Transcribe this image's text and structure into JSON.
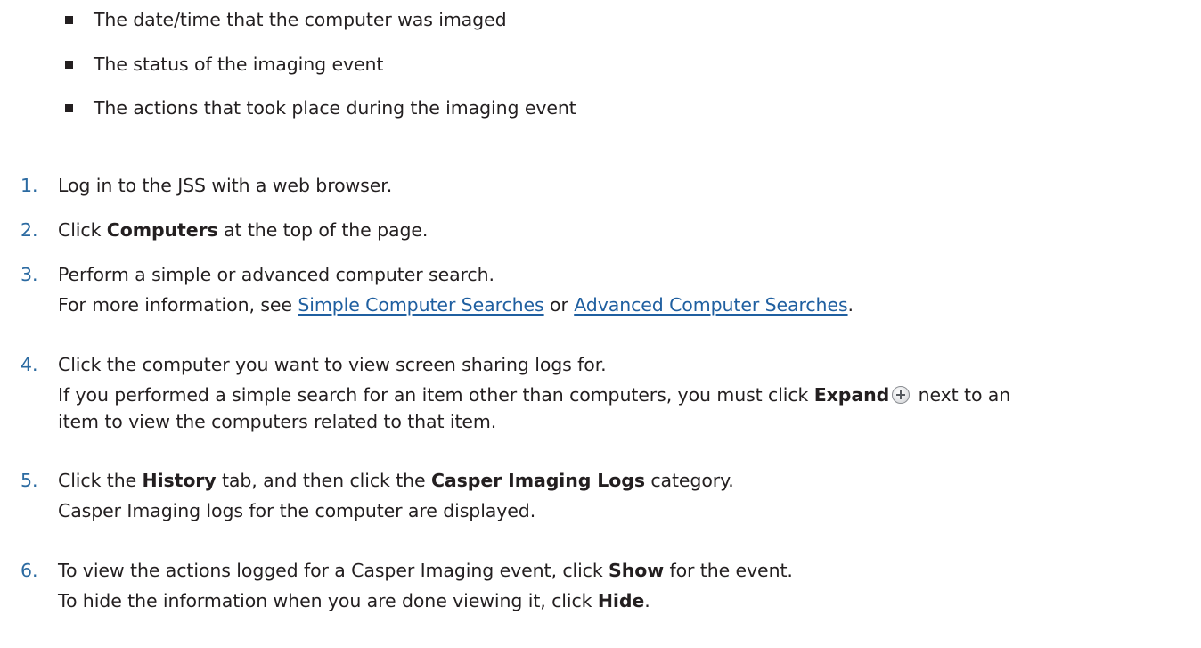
{
  "bullets": [
    "The date/time that the computer was imaged",
    "The status of the imaging event",
    "The actions that took place during the imaging event"
  ],
  "steps": [
    {
      "number": "1.",
      "text": "Log in to the JSS with a web browser."
    },
    {
      "number": "2.",
      "pre": "Click ",
      "bold": "Computers",
      "post": " at the top of the page."
    },
    {
      "number": "3.",
      "text": "Perform a simple or advanced computer search.",
      "detail_pre": "For more information, see ",
      "link1": "Simple Computer Searches",
      "detail_mid": " or ",
      "link2": "Advanced Computer Searches",
      "detail_post": "."
    },
    {
      "number": "4.",
      "text": "Click the computer you want to view screen sharing logs for.",
      "detail_pre": "If you performed a simple search for an item other than computers, you must click ",
      "detail_bold": "Expand",
      "detail_post": " next to an",
      "detail_line2": "item to view the computers related to that item.",
      "icon": "expand-plus-icon"
    },
    {
      "number": "5.",
      "pre": "Click the ",
      "bold1": "History",
      "mid": " tab, and then click the ",
      "bold2": "Casper Imaging Logs",
      "post": " category.",
      "detail": "Casper Imaging logs for the computer are displayed."
    },
    {
      "number": "6.",
      "pre": "To view the actions logged for a Casper Imaging event, click ",
      "bold": "Show",
      "post": " for the event.",
      "detail_pre": "To hide the information when you are done viewing it, click ",
      "detail_bold": "Hide",
      "detail_post": "."
    }
  ]
}
